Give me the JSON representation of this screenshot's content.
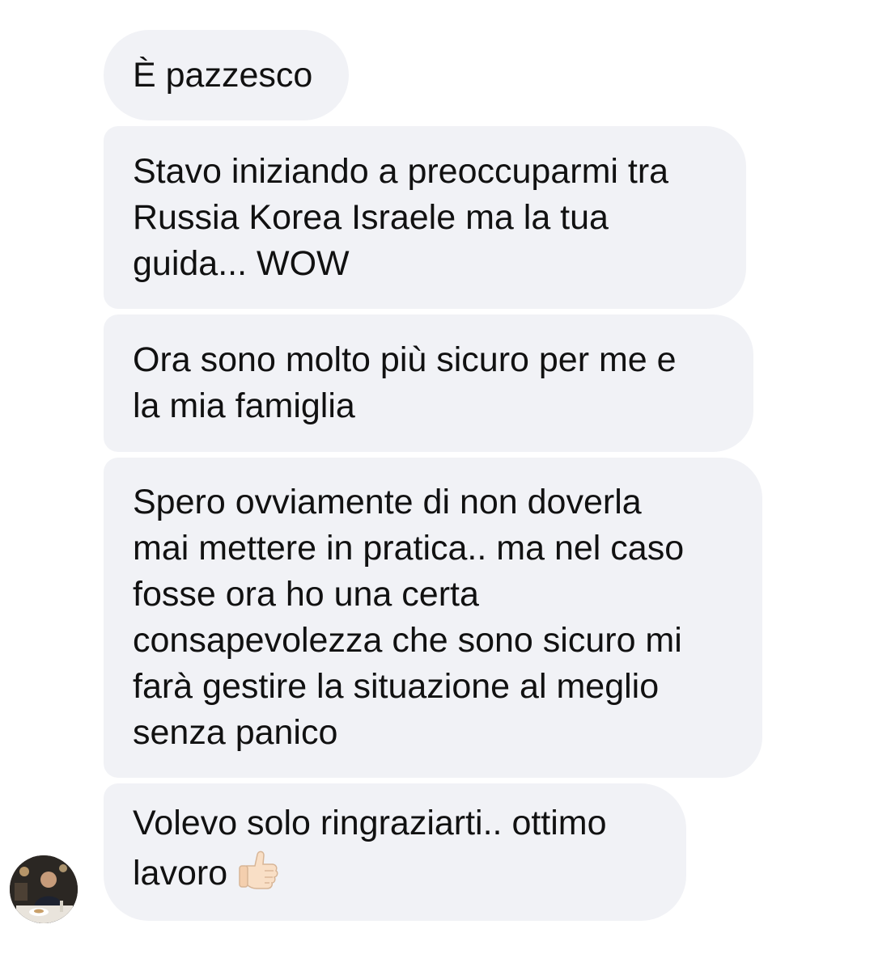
{
  "conversation": {
    "messages": [
      {
        "text": "È pazzesco"
      },
      {
        "text": "Stavo iniziando a preoccuparmi tra\nRussia Korea Israele ma la tua\nguida... WOW"
      },
      {
        "text": "Ora sono molto più sicuro per me e\nla mia famiglia"
      },
      {
        "text": "Spero ovviamente di non doverla\nmai mettere in pratica.. ma nel caso\nfosse ora ho una certa\nconsapevolezza che sono sicuro mi\nfarà gestire la situazione al meglio\nsenza panico"
      },
      {
        "text": "Volevo solo ringraziarti.. ottimo\nlavoro",
        "emoji": "thumbs-up-icon"
      }
    ],
    "sender_avatar": "avatar-photo",
    "colors": {
      "bubble_background": "#f1f2f6",
      "text": "#111111",
      "page_background": "#ffffff"
    }
  }
}
